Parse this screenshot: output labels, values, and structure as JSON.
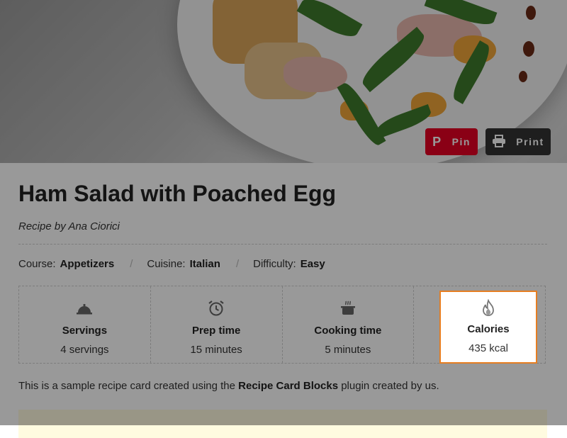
{
  "hero": {
    "pin_label": "Pin",
    "print_label": "Print"
  },
  "recipe": {
    "title": "Ham Salad with Poached Egg",
    "author_prefix": "Recipe by",
    "author_name": "Ana Ciorici",
    "meta": [
      {
        "label": "Course:",
        "value": "Appetizers"
      },
      {
        "label": "Cuisine:",
        "value": "Italian"
      },
      {
        "label": "Difficulty:",
        "value": "Easy"
      }
    ],
    "details": [
      {
        "icon": "serving-cloche-icon",
        "label": "Servings",
        "value": "4 servings"
      },
      {
        "icon": "alarm-clock-icon",
        "label": "Prep time",
        "value": "15 minutes"
      },
      {
        "icon": "cooking-pot-icon",
        "label": "Cooking time",
        "value": "5 minutes"
      },
      {
        "icon": "flame-icon",
        "label": "Calories",
        "value": "435 kcal"
      }
    ],
    "description": {
      "before": "This is a sample recipe card created using the",
      "bold": "Recipe Card Blocks",
      "after": "plugin created by us."
    }
  },
  "colors": {
    "pin": "#e60023",
    "print": "#333333",
    "highlight_border": "#e67e22"
  }
}
